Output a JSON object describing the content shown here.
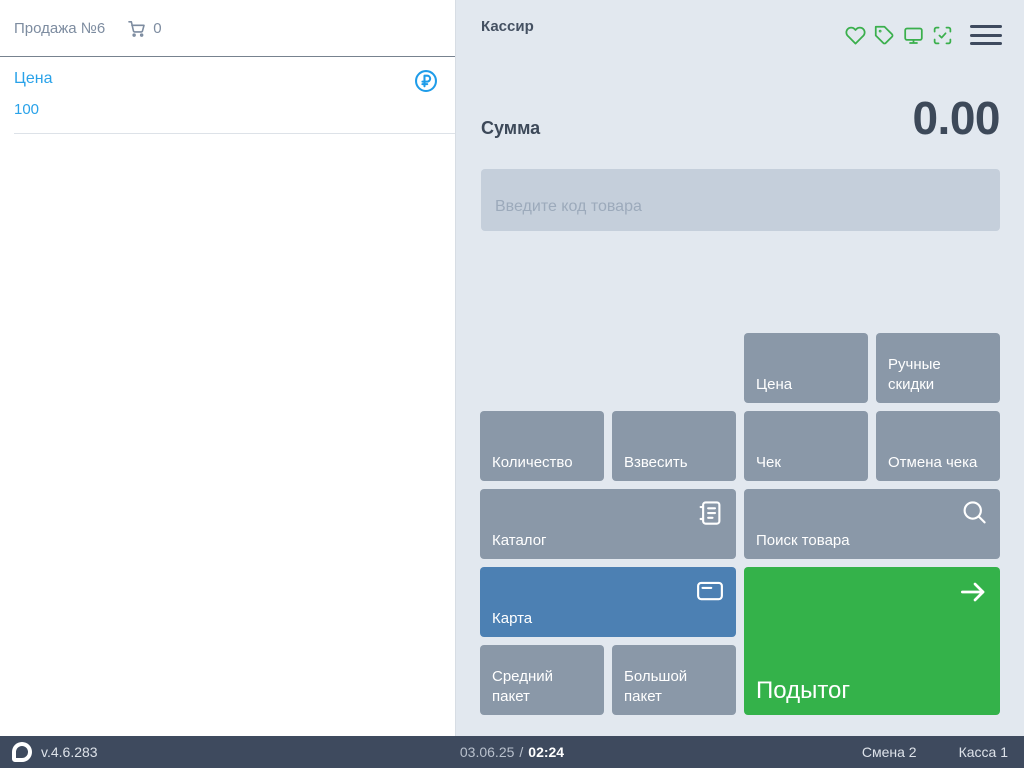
{
  "left_panel": {
    "sale_title": "Продажа №6",
    "cart_count": "0",
    "items": [
      {
        "label": "Цена",
        "value": "100",
        "icon": "ruble-circle-icon"
      }
    ]
  },
  "right_panel": {
    "cashier_label": "Кассир",
    "header_icons": [
      "heart-icon",
      "tag-icon",
      "monitor-icon",
      "scan-check-icon",
      "menu-icon"
    ],
    "sum_label": "Сумма",
    "sum_value": "0.00",
    "code_input": {
      "value": "",
      "placeholder": "Введите код товара"
    },
    "buttons": {
      "price": "Цена",
      "manual_discounts": "Ручные скидки",
      "quantity": "Количество",
      "weigh": "Взвесить",
      "receipt": "Чек",
      "cancel_receipt": "Отмена чека",
      "catalog": "Каталог",
      "product_search": "Поиск товара",
      "card": "Карта",
      "subtotal": "Подытог",
      "medium_bag": "Средний пакет",
      "large_bag": "Большой пакет"
    },
    "button_icons": {
      "catalog": "catalog-icon",
      "product_search": "search-icon",
      "card": "card-icon",
      "subtotal": "arrow-right-icon"
    }
  },
  "statusbar": {
    "version": "v.4.6.283",
    "date": "03.06.25",
    "separator": "/",
    "time": "02:24",
    "shift": "Смена 2",
    "register": "Касса 1"
  },
  "colors": {
    "accent_blue": "#29a2e9",
    "panel_bg": "#e2e8ef",
    "button_gray": "#8a98a8",
    "button_blue": "#4c80b3",
    "button_green": "#34b24a",
    "icon_green": "#3aaf4c",
    "statusbar_bg": "#3e4a5e",
    "dark_text": "#3d4959"
  }
}
